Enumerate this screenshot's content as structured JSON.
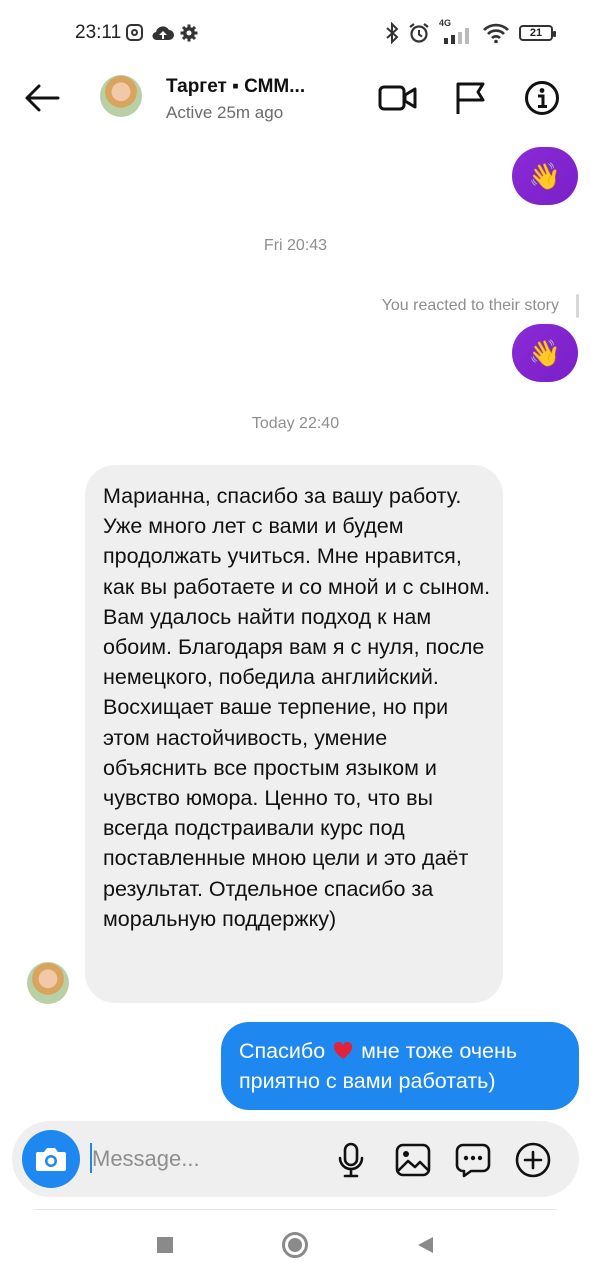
{
  "status_bar": {
    "time": "23:11",
    "network": "4G",
    "battery": "21"
  },
  "header": {
    "contact_name": "Таргет ▪ СММ...",
    "contact_status": "Active 25m ago"
  },
  "conversation": {
    "reaction_emoji": "👋",
    "timestamp_1": "Fri 20:43",
    "story_reaction_note": "You reacted to their story",
    "timestamp_2": "Today 22:40",
    "incoming_message": "Марианна, спасибо за вашу работу. Уже много лет с вами и будем продолжать учиться. Мне нравится, как вы работаете и со мной и с сыном. Вам удалось найти подход к нам обоим. Благодаря вам я с нуля, после немецкого, победила английский. Восхищает ваше терпение, но при этом настойчивость, умение объяснить все простым языком и чувство юмора. Ценно то, что вы всегда подстраивали курс под поставленные мною цели и это даёт результат. Отдельное спасибо за моральную поддержку)",
    "outgoing_message_before": "Спасибо",
    "outgoing_message_after": "мне тоже очень приятно с вами работать)"
  },
  "composer": {
    "placeholder": "Message..."
  },
  "colors": {
    "accent_blue": "#1e88f0",
    "reaction_purple": "#8a2bd6",
    "incoming_bubble": "#efefef",
    "heart_red": "#e0223a"
  },
  "icons": [
    "back-arrow-icon",
    "video-call-icon",
    "flag-icon",
    "info-icon",
    "camera-icon",
    "microphone-icon",
    "gallery-icon",
    "sticker-icon",
    "plus-icon"
  ]
}
